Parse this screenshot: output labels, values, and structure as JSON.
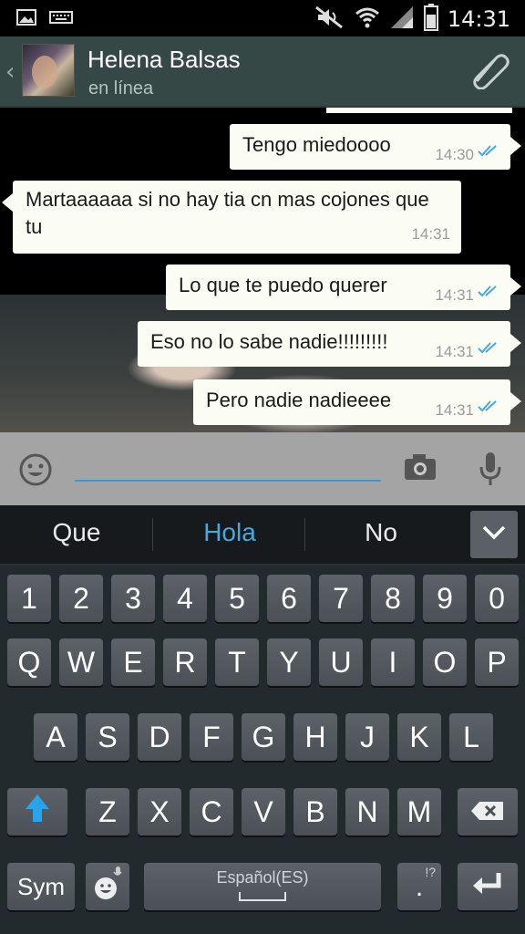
{
  "statusbar": {
    "time": "14:31",
    "icons": [
      "gallery-icon",
      "keyboard-icon",
      "mute-icon",
      "wifi-icon",
      "signal-icon",
      "battery-icon"
    ]
  },
  "header": {
    "back_symbol": "‹",
    "contact_name": "Helena Balsas",
    "contact_status": "en línea"
  },
  "messages": [
    {
      "direction": "out",
      "text": "Tengo miedoooo",
      "time": "14:30"
    },
    {
      "direction": "in",
      "text": "Martaaaaaa si no hay tia cn mas cojones que tu",
      "time": "14:31"
    },
    {
      "direction": "out",
      "text": "Lo que te puedo querer",
      "time": "14:31"
    },
    {
      "direction": "out",
      "text": "Eso no lo sabe nadie!!!!!!!!!",
      "time": "14:31"
    },
    {
      "direction": "out",
      "text": "Pero nadie nadieeee",
      "time": "14:31"
    }
  ],
  "input": {
    "value": "",
    "placeholder": ""
  },
  "suggestions": [
    "Que",
    "Hola",
    "No"
  ],
  "colors": {
    "accent": "#3b9ad6",
    "header_bg": "#364845",
    "bubble_bg": "#fbfdf4",
    "tick": "#4aa7e0"
  },
  "keyboard": {
    "row_numbers": [
      "1",
      "2",
      "3",
      "4",
      "5",
      "6",
      "7",
      "8",
      "9",
      "0"
    ],
    "row1": [
      "Q",
      "W",
      "E",
      "R",
      "T",
      "Y",
      "U",
      "I",
      "O",
      "P"
    ],
    "row2": [
      "A",
      "S",
      "D",
      "F",
      "G",
      "H",
      "J",
      "K",
      "L"
    ],
    "row3": [
      "Z",
      "X",
      "C",
      "V",
      "B",
      "N",
      "M"
    ],
    "sym_label": "Sym",
    "space_label": "Español(ES)",
    "period_label": ".",
    "period_hint": "!?"
  }
}
